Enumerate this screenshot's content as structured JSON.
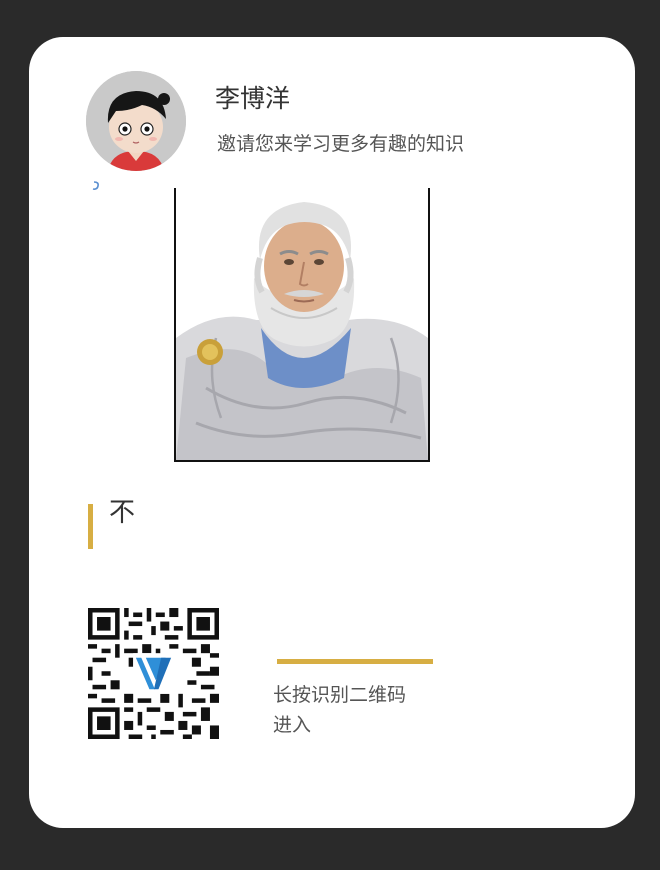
{
  "profile": {
    "name": "李博洋",
    "subtitle": "邀请您来学习更多有趣的知识"
  },
  "post": {
    "image_subject": "aristotle-bust-illustration",
    "quote": "不"
  },
  "invite": {
    "hint_line1": "长按识别二维码",
    "hint_line2": "进入"
  },
  "colors": {
    "background": "#2a2a2a",
    "card": "#ffffff",
    "accent": "#d7ae43",
    "text": "#333333"
  }
}
